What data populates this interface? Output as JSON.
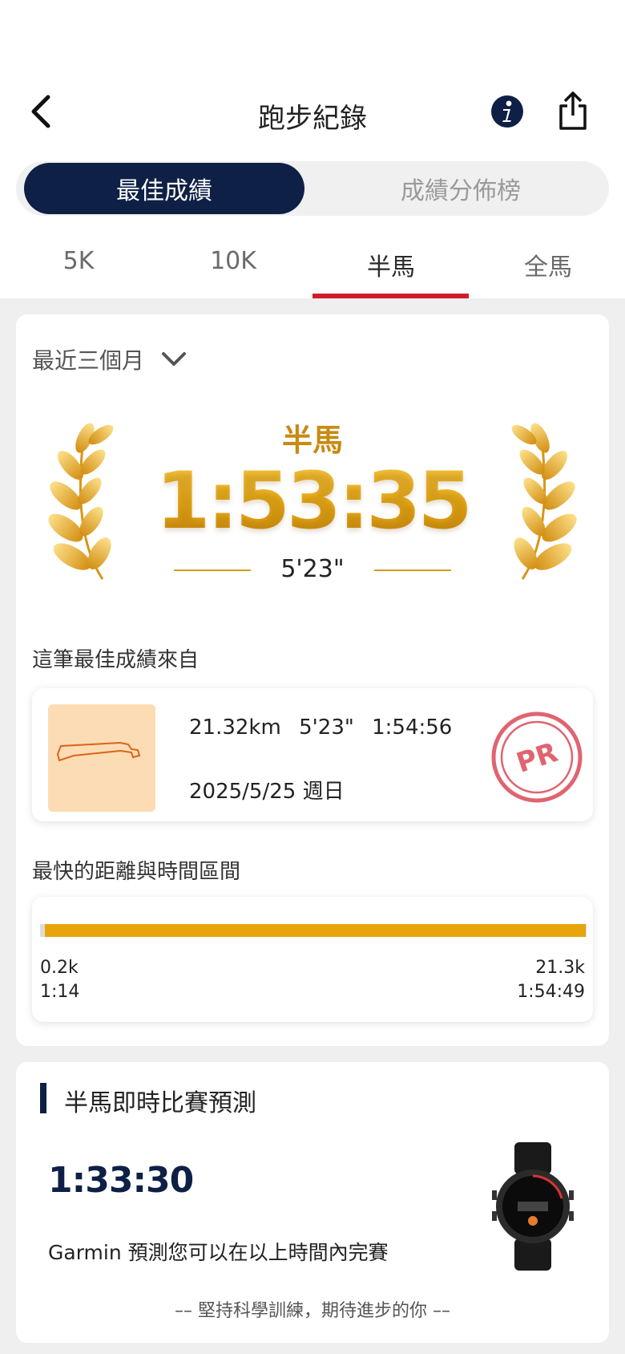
{
  "header": {
    "title": "跑步紀錄"
  },
  "segment": {
    "best": "最佳成績",
    "distribution": "成績分佈榜"
  },
  "tabs": [
    "5K",
    "10K",
    "半馬",
    "全馬"
  ],
  "active_tab": "半馬",
  "best_card": {
    "range": "最近三個月",
    "distance": "半馬",
    "best_time": "1:53:35",
    "pace": "5'23\"",
    "from_label": "這筆最佳成績來自",
    "activity": {
      "distance": "21.32km",
      "pace": "5'23\"",
      "time": "1:54:56",
      "date": "2025/5/25 週日"
    },
    "pr_badge": "PR",
    "fastest_label": "最快的距離與時間區間",
    "fastest": {
      "start_dist": "0.2k",
      "start_time": "1:14",
      "end_dist": "21.3k",
      "end_time": "1:54:49",
      "segment_start_km": 0.2,
      "segment_end_km": 21.3,
      "total_km": 21.32
    }
  },
  "prediction": {
    "title": "半馬即時比賽預測",
    "time": "1:33:30",
    "desc": "Garmin 預測您可以在以上時間內完賽",
    "footer": "–– 堅持科學訓練，期待進步的你 ––"
  },
  "colors": {
    "navy": "#0e2046",
    "gold": "#e6a50a",
    "red": "#d01c2a",
    "pr_red": "#e06470"
  }
}
